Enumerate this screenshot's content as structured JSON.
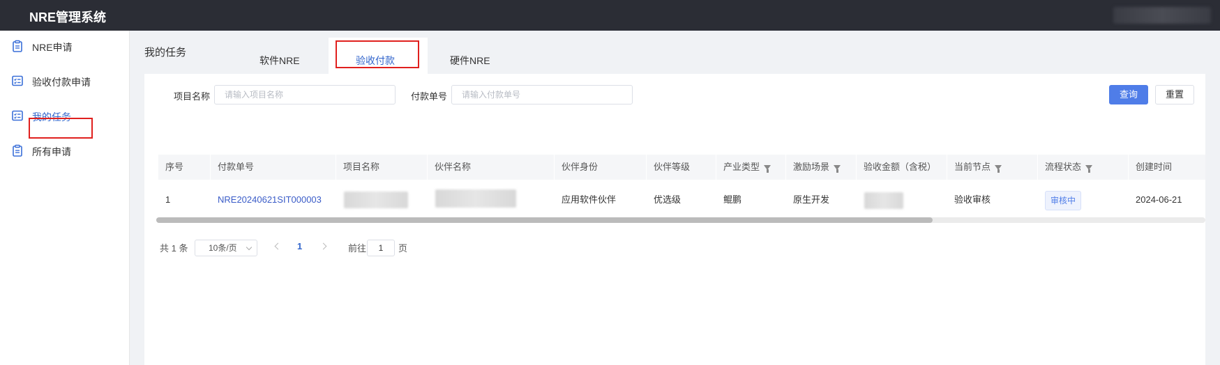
{
  "app": {
    "title": "NRE管理系统"
  },
  "sidebar": {
    "items": [
      {
        "label": "NRE申请",
        "icon": "clipboard-icon"
      },
      {
        "label": "验收付款申请",
        "icon": "checklist-icon"
      },
      {
        "label": "我的任务",
        "icon": "checklist-icon",
        "active": true
      },
      {
        "label": "所有申请",
        "icon": "clipboard-icon"
      }
    ]
  },
  "page": {
    "title": "我的任务"
  },
  "tabs": [
    {
      "label": "软件NRE"
    },
    {
      "label": "验收付款",
      "active": true
    },
    {
      "label": "硬件NRE"
    }
  ],
  "filters": {
    "project_label": "项目名称",
    "project_placeholder": "请输入项目名称",
    "payment_label": "付款单号",
    "payment_placeholder": "请输入付款单号",
    "query_button": "查询",
    "reset_button": "重置"
  },
  "table": {
    "columns": [
      "序号",
      "付款单号",
      "项目名称",
      "伙伴名称",
      "伙伴身份",
      "伙伴等级",
      "产业类型",
      "激励场景",
      "验收金额（含税）",
      "当前节点",
      "流程状态",
      "创建时间"
    ],
    "filterable_columns": [
      "产业类型",
      "激励场景",
      "当前节点",
      "流程状态"
    ],
    "rows": [
      {
        "index": "1",
        "payment_no": "NRE20240621SIT000003",
        "partner_identity": "应用软件伙伴",
        "partner_level": "优选级",
        "industry_type": "鲲鹏",
        "scenario": "原生开发",
        "current_node": "验收审核",
        "status": "审核中",
        "created": "2024-06-21"
      }
    ]
  },
  "pagination": {
    "total": "共 1 条",
    "page_size": "10条/页",
    "current_page": "1",
    "goto_label": "前往",
    "goto_value": "1",
    "page_suffix": "页"
  },
  "colors": {
    "topbar": "#2b2d35",
    "accent": "#4f7de8",
    "link": "#3a5cc8",
    "highlight_box": "#e0201e"
  }
}
